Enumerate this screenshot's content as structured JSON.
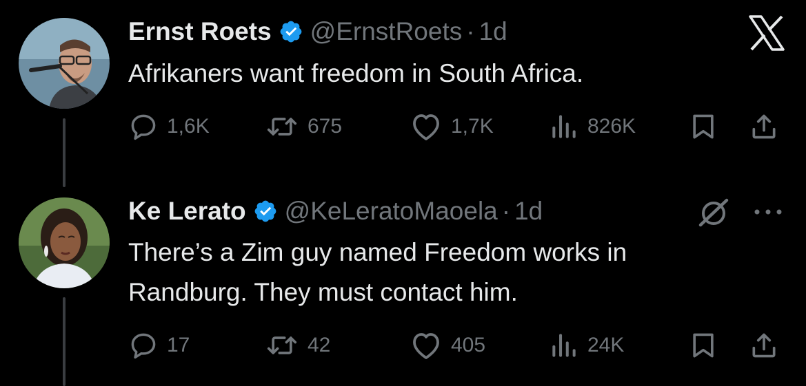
{
  "tweets": [
    {
      "name": "Ernst Roets",
      "handle": "@ErnstRoets",
      "separator": "·",
      "time": "1d",
      "text": "Afrikaners want freedom in South Africa.",
      "replies": "1,6K",
      "reposts": "675",
      "likes": "1,7K",
      "views": "826K",
      "corner_icon": "x-logo-icon"
    },
    {
      "name": "Ke Lerato",
      "handle": "@KeLeratoMaoela",
      "separator": "·",
      "time": "1d",
      "text": "There’s a Zim guy named Freedom works in\nRandburg. They must contact him.",
      "replies": "17",
      "reposts": "42",
      "likes": "405",
      "views": "24K",
      "corner_icon": "grok-icon"
    }
  ],
  "colors": {
    "background": "#000000",
    "primary_text": "#e7e9ea",
    "secondary_text": "#71767b",
    "verified_badge": "#1d9bf0",
    "thread_line": "#3a3d41"
  }
}
